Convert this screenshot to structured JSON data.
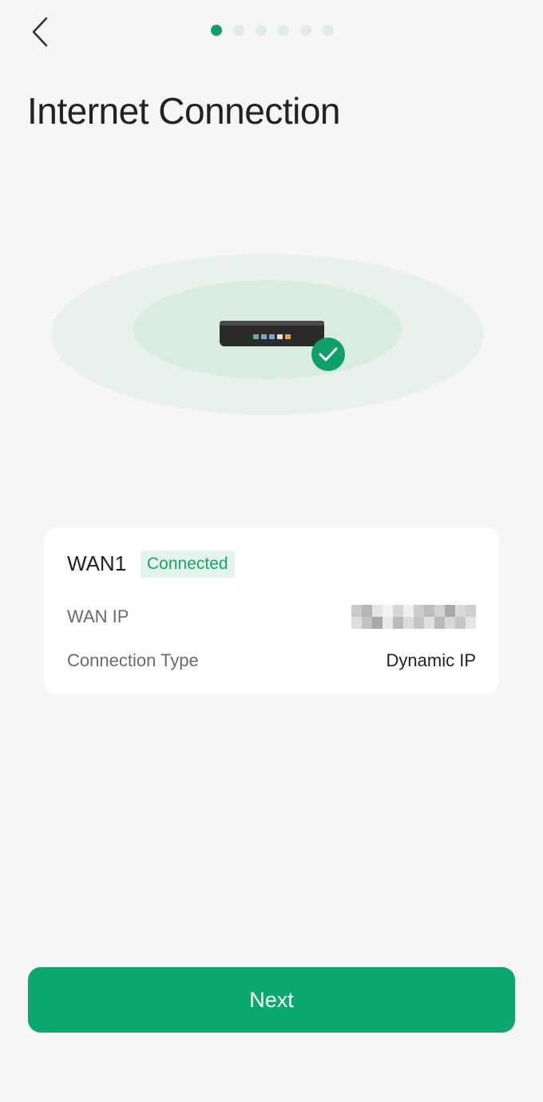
{
  "header": {
    "back_icon": "chevron-left-icon",
    "steps_total": 6,
    "current_step": 1
  },
  "title": "Internet Connection",
  "illustration": {
    "device_icon": "router-icon",
    "status_icon": "check-icon",
    "accent_color": "#0fa06a"
  },
  "wan_card": {
    "name": "WAN1",
    "status": "Connected",
    "rows": [
      {
        "label": "WAN IP",
        "value": ""
      },
      {
        "label": "Connection Type",
        "value": "Dynamic IP"
      }
    ]
  },
  "next_label": "Next",
  "colors": {
    "primary": "#0aa86e",
    "background": "#f6f6f6",
    "badge_bg": "#e4f4ec"
  }
}
